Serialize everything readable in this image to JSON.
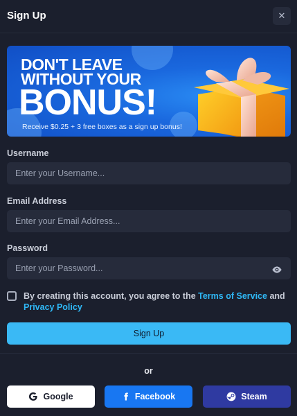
{
  "header": {
    "title": "Sign Up",
    "close_symbol": "✕"
  },
  "banner": {
    "line1": "DON'T LEAVE",
    "line2": "WITHOUT YOUR",
    "big": "BONUS!",
    "subtitle": "Receive $0.25 + 3 free boxes as a sign up bonus!",
    "image": "gift-box-icon"
  },
  "form": {
    "username_label": "Username",
    "username_placeholder": "Enter your Username...",
    "email_label": "Email Address",
    "email_placeholder": "Enter your Email Address...",
    "password_label": "Password",
    "password_placeholder": "Enter your Password...",
    "password_toggle_icon": "eye-icon"
  },
  "agreement": {
    "checked": false,
    "text_before": "By creating this account, you agree to the ",
    "terms_link": "Terms of Service",
    "text_middle": " and ",
    "privacy_link": "Privacy Policy"
  },
  "signup_button": "Sign Up",
  "or_text": "or",
  "social": {
    "google": {
      "label": "Google",
      "icon": "google-icon"
    },
    "facebook": {
      "label": "Facebook",
      "icon": "facebook-icon"
    },
    "steam": {
      "label": "Steam",
      "icon": "steam-icon"
    }
  },
  "colors": {
    "background": "#1b1f2d",
    "input_bg": "#262b3b",
    "accent": "#3ab9f5",
    "link": "#2fb8f6",
    "facebook": "#1877f2",
    "steam": "#2f3aa1"
  }
}
